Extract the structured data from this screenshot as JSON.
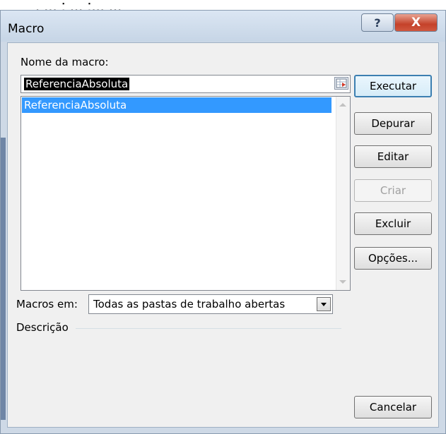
{
  "background_stub": ", ... ; ... ;... ... ",
  "window": {
    "title": "Macro",
    "help_glyph": "?",
    "close_glyph": "X"
  },
  "macro_name": {
    "label": "Nome da macro:",
    "value": "ReferenciaAbsoluta"
  },
  "macro_list": {
    "items": [
      "ReferenciaAbsoluta"
    ],
    "selected_index": 0
  },
  "buttons": {
    "run": "Executar",
    "step_into": "Depurar",
    "edit": "Editar",
    "create": "Criar",
    "delete": "Excluir",
    "options": "Opções...",
    "cancel": "Cancelar"
  },
  "macros_in": {
    "label": "Macros em:",
    "value": "Todas as pastas de trabalho abertas"
  },
  "description": {
    "label": "Descrição"
  },
  "colors": {
    "selection": "#3399ff",
    "close_button": "#c4422a",
    "titlebar": "#dbe6f3"
  }
}
